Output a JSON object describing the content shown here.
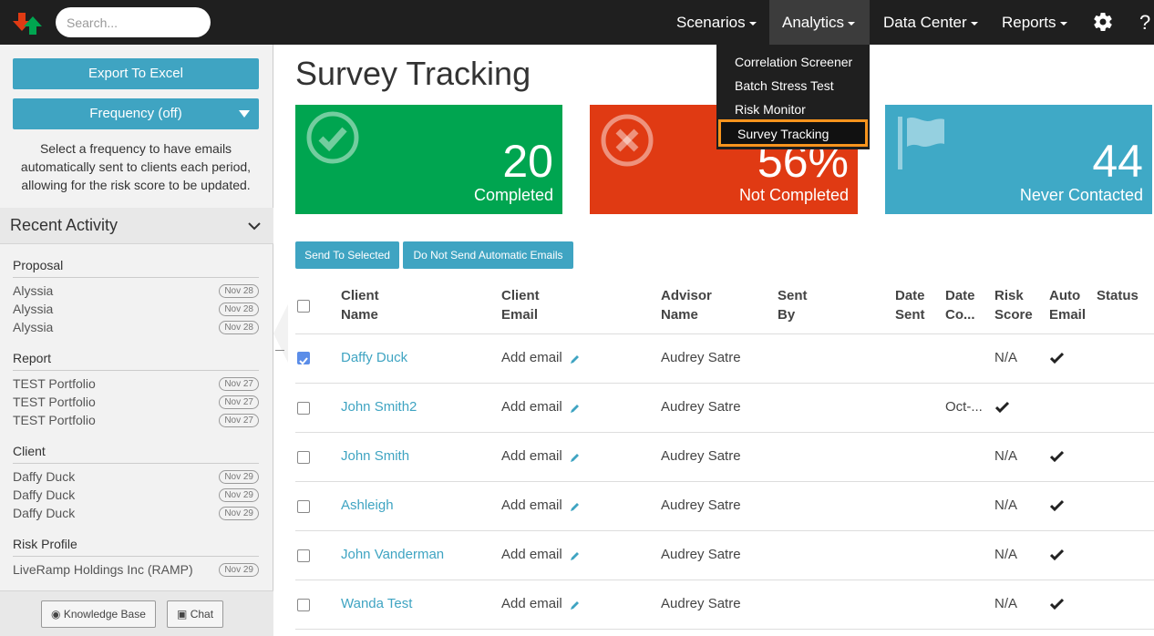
{
  "nav": {
    "search_placeholder": "Search...",
    "items": [
      {
        "label": "Scenarios"
      },
      {
        "label": "Analytics"
      },
      {
        "label": "Data Center"
      },
      {
        "label": "Reports"
      }
    ],
    "help": "?"
  },
  "analytics_menu": {
    "items": [
      "Correlation Screener",
      "Batch Stress Test",
      "Risk Monitor",
      "Survey Tracking"
    ],
    "highlighted": "Survey Tracking"
  },
  "sidebar": {
    "export_label": "Export To Excel",
    "frequency_label": "Frequency (off)",
    "frequency_help": "Select a frequency to have emails automatically sent to clients each period, allowing for the risk score to be updated.",
    "recent_title": "Recent Activity",
    "groups": [
      {
        "title": "Proposal",
        "items": [
          {
            "name": "Alyssia",
            "date": "Nov 28"
          },
          {
            "name": "Alyssia",
            "date": "Nov 28"
          },
          {
            "name": "Alyssia",
            "date": "Nov 28"
          }
        ]
      },
      {
        "title": "Report",
        "items": [
          {
            "name": "TEST Portfolio",
            "date": "Nov 27"
          },
          {
            "name": "TEST Portfolio",
            "date": "Nov 27"
          },
          {
            "name": "TEST Portfolio",
            "date": "Nov 27"
          }
        ]
      },
      {
        "title": "Client",
        "items": [
          {
            "name": "Daffy Duck",
            "date": "Nov 29"
          },
          {
            "name": "Daffy Duck",
            "date": "Nov 29"
          },
          {
            "name": "Daffy Duck",
            "date": "Nov 29"
          }
        ]
      },
      {
        "title": "Risk Profile",
        "items": [
          {
            "name": "LiveRamp Holdings Inc (RAMP)",
            "date": "Nov 29"
          }
        ]
      }
    ],
    "knowledge_base": "Knowledge Base",
    "chat": "Chat"
  },
  "main": {
    "title": "Survey Tracking",
    "cards": [
      {
        "value": "20",
        "label": "Completed",
        "color": "#00a550"
      },
      {
        "value": "56%",
        "label": "Not Completed",
        "color": "#e03a13"
      },
      {
        "value": "44",
        "label": "Never Contacted",
        "color": "#3fa9c6"
      }
    ],
    "send_selected": "Send To Selected",
    "do_not_send": "Do Not Send Automatic Emails",
    "columns": [
      {
        "l1": "Client",
        "l2": "Name"
      },
      {
        "l1": "Client",
        "l2": "Email"
      },
      {
        "l1": "Advisor",
        "l2": "Name"
      },
      {
        "l1": "Sent",
        "l2": "By"
      },
      {
        "l1": "Date",
        "l2": "Sent"
      },
      {
        "l1": "Date",
        "l2": "Co..."
      },
      {
        "l1": "Risk",
        "l2": "Score"
      },
      {
        "l1": "Auto",
        "l2": "Email"
      },
      {
        "l1": "Status",
        "l2": ""
      }
    ],
    "rows": [
      {
        "name": "Daffy Duck",
        "email": "Add email",
        "advisor": "Audrey Satre",
        "date_completed": "",
        "risk": "N/A",
        "auto_email": true,
        "checked": true
      },
      {
        "name": "John Smith2",
        "email": "Add email",
        "advisor": "Audrey Satre",
        "date_completed": "Oct-...",
        "risk": "",
        "auto_email": true,
        "checked": false
      },
      {
        "name": "John Smith",
        "email": "Add email",
        "advisor": "Audrey Satre",
        "date_completed": "",
        "risk": "N/A",
        "auto_email": true,
        "checked": false
      },
      {
        "name": "Ashleigh",
        "email": "Add email",
        "advisor": "Audrey Satre",
        "date_completed": "",
        "risk": "N/A",
        "auto_email": true,
        "checked": false
      },
      {
        "name": "John Vanderman",
        "email": "Add email",
        "advisor": "Audrey Satre",
        "date_completed": "",
        "risk": "N/A",
        "auto_email": true,
        "checked": false
      },
      {
        "name": "Wanda Test",
        "email": "Add email",
        "advisor": "Audrey Satre",
        "date_completed": "",
        "risk": "N/A",
        "auto_email": true,
        "checked": false
      }
    ]
  }
}
